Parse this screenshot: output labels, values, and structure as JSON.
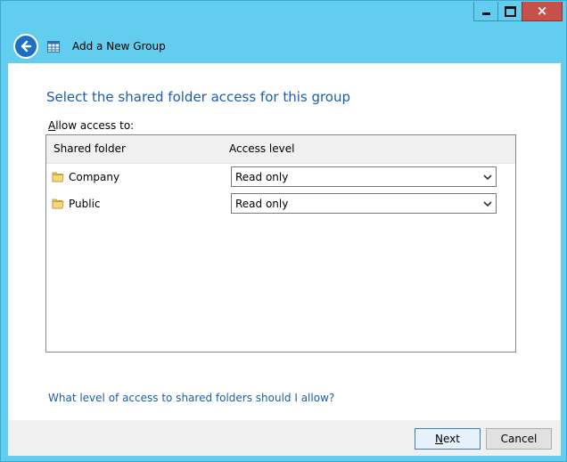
{
  "window": {
    "title": "Add a New Group",
    "caption_buttons": {
      "minimize_icon": "minimize-icon",
      "maximize_icon": "maximize-icon",
      "close_icon": "close-icon",
      "close_glyph": "×"
    }
  },
  "header": {
    "back_icon": "arrow-left-icon",
    "app_icon": "group-grid-icon"
  },
  "main": {
    "heading": "Select the shared folder access for this group",
    "allow_label_accel": "A",
    "allow_label_rest": "llow access to:",
    "columns": {
      "shared_folder": "Shared folder",
      "access_level": "Access level"
    },
    "rows": [
      {
        "folder": "Company",
        "access": "Read only",
        "icon": "folder-icon"
      },
      {
        "folder": "Public",
        "access": "Read only",
        "icon": "folder-icon"
      }
    ],
    "help_link": "What level of access to shared folders should I allow?"
  },
  "footer": {
    "next_accel": "N",
    "next_rest": "ext",
    "cancel": "Cancel"
  },
  "colors": {
    "frame": "#62cdee",
    "heading": "#1a5fa6",
    "link": "#1a5fa6",
    "close_button": "#c7504b",
    "back_button": "#1e6fc2"
  }
}
